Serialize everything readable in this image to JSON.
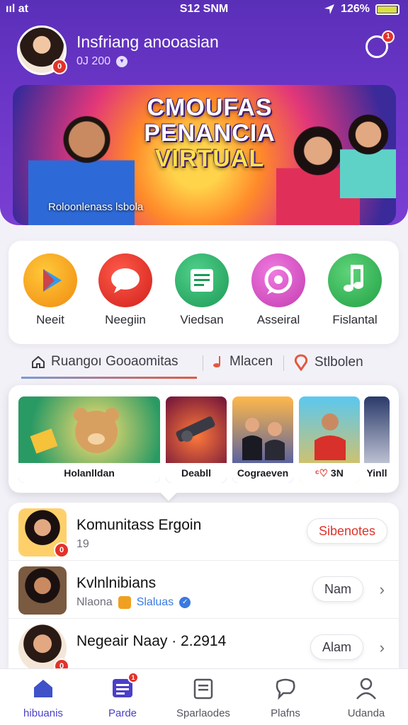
{
  "status_bar": {
    "left": "ııl at",
    "time": "S12 SNM",
    "battery": "126%"
  },
  "header": {
    "title": "Insfriang anooasian",
    "subtitle": "0J 200",
    "avatar_badge": "0",
    "notif_badge": "1"
  },
  "banner": {
    "title_line1": "CMOUFAS",
    "title_line2": "PENANCIA",
    "title_line3": "VIRTUAL",
    "caption": "Roloonlenass lsbola"
  },
  "categories": [
    {
      "label": "Neeit",
      "icon": "play-store-icon",
      "color": "#f7a11e"
    },
    {
      "label": "Neegiin",
      "icon": "chat-bubble-icon",
      "color": "#e8362a"
    },
    {
      "label": "Viedsan",
      "icon": "list-document-icon",
      "color": "#2fae6a"
    },
    {
      "label": "Asseiral",
      "icon": "chat-ring-icon",
      "color": "#d64bc6"
    },
    {
      "label": "Fislantal",
      "icon": "music-note-icon",
      "color": "#34b95c"
    }
  ],
  "tabs": [
    {
      "label": "Ruangoı Gooaomitas",
      "icon": "home-icon"
    },
    {
      "label": "Mlacen",
      "icon": "music-icon"
    },
    {
      "label": "Stlbolen",
      "icon": "location-pin-icon"
    }
  ],
  "games": [
    {
      "label": "Holanlldan"
    },
    {
      "label": "Deabll"
    },
    {
      "label": "Cograeven"
    },
    {
      "label": "3N"
    },
    {
      "label": "Yinll"
    }
  ],
  "list": [
    {
      "name": "Komunitass Ergoin",
      "sub": "19",
      "action": "Sibenotes",
      "badge": "0"
    },
    {
      "name": "Kvlnlnibians",
      "sub": "Nlaona",
      "sub2": "Slaluas",
      "action": "Nam"
    },
    {
      "name": "Negeair Naay · 2.2914",
      "sub": "",
      "action": "Alam",
      "badge": "0"
    }
  ],
  "nav": [
    {
      "label": "hibuanis",
      "icon": "home-icon"
    },
    {
      "label": "Parde",
      "icon": "list-icon",
      "badge": "1"
    },
    {
      "label": "Sparlaodes",
      "icon": "clipboard-icon"
    },
    {
      "label": "Plafns",
      "icon": "chat-icon"
    },
    {
      "label": "Udanda",
      "icon": "user-icon"
    }
  ]
}
